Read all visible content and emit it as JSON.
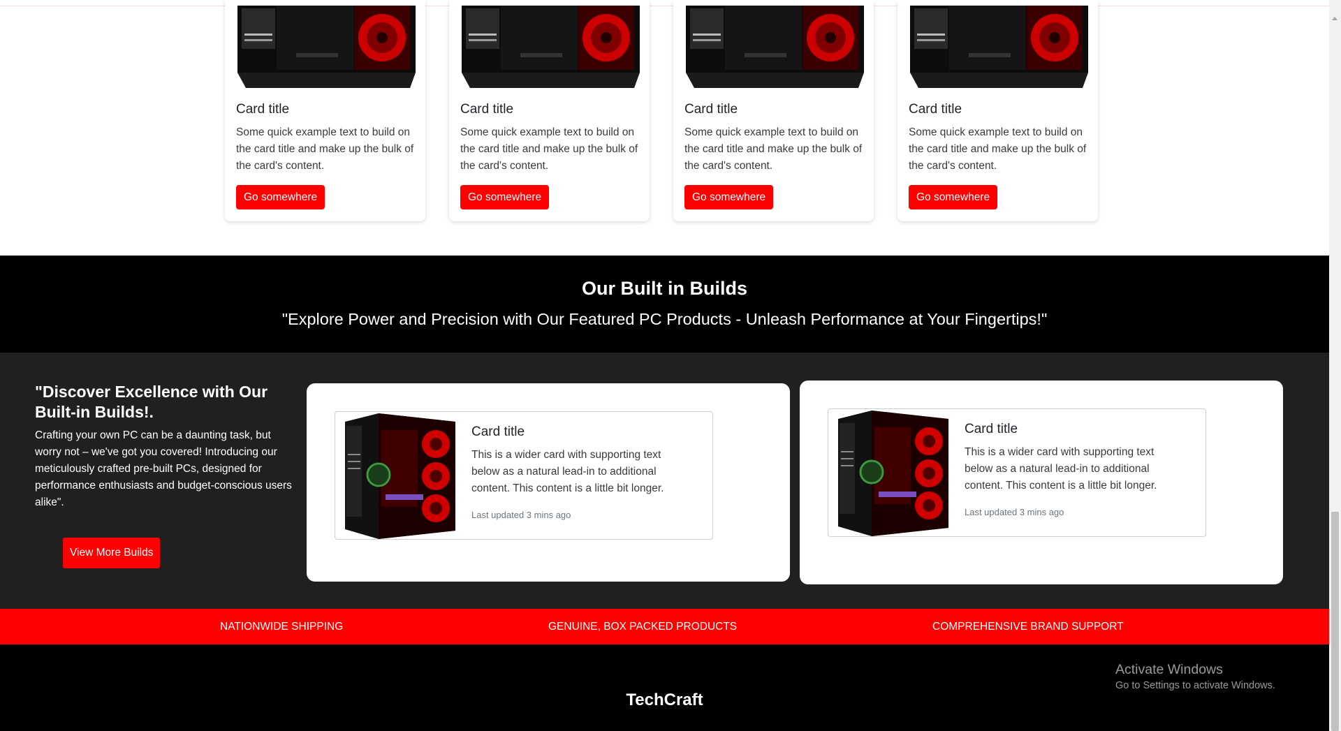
{
  "product_cards": [
    {
      "title": "Card title",
      "text": "Some quick example text to build on the card title and make up the bulk of the card's content.",
      "button": "Go somewhere"
    },
    {
      "title": "Card title",
      "text": "Some quick example text to build on the card title and make up the bulk of the card's content.",
      "button": "Go somewhere"
    },
    {
      "title": "Card title",
      "text": "Some quick example text to build on the card title and make up the bulk of the card's content.",
      "button": "Go somewhere"
    },
    {
      "title": "Card title",
      "text": "Some quick example text to build on the card title and make up the bulk of the card's content.",
      "button": "Go somewhere"
    }
  ],
  "built_section": {
    "heading": "Our Built in Builds",
    "tagline": "\"Explore Power and Precision with Our Featured PC Products - Unleash Performance at Your Fingertips!\""
  },
  "promo": {
    "title": "\"Discover Excellence with Our Built-in Builds!.",
    "text": "Crafting your own PC can be a daunting task, but worry not – we've got you covered! Introducing our meticulously crafted pre-built PCs, designed for performance enthusiasts and budget-conscious users alike\".",
    "button": "View More Builds"
  },
  "wide_cards": [
    {
      "title": "Card title",
      "text": "This is a wider card with supporting text below as a natural lead-in to additional content. This content is a little bit longer.",
      "meta": "Last updated 3 mins ago"
    },
    {
      "title": "Card title",
      "text": "This is a wider card with supporting text below as a natural lead-in to additional content. This content is a little bit longer.",
      "meta": "Last updated 3 mins ago"
    }
  ],
  "features": [
    "NATIONWIDE SHIPPING",
    "GENUINE, BOX PACKED PRODUCTS",
    "COMPREHENSIVE BRAND SUPPORT"
  ],
  "footer": {
    "brand": "TechCraft"
  },
  "watermark": {
    "line1": "Activate Windows",
    "line2": "Go to Settings to activate Windows."
  },
  "colors": {
    "accent_red": "#ff0000",
    "dark_section": "#202020",
    "black": "#000000"
  }
}
